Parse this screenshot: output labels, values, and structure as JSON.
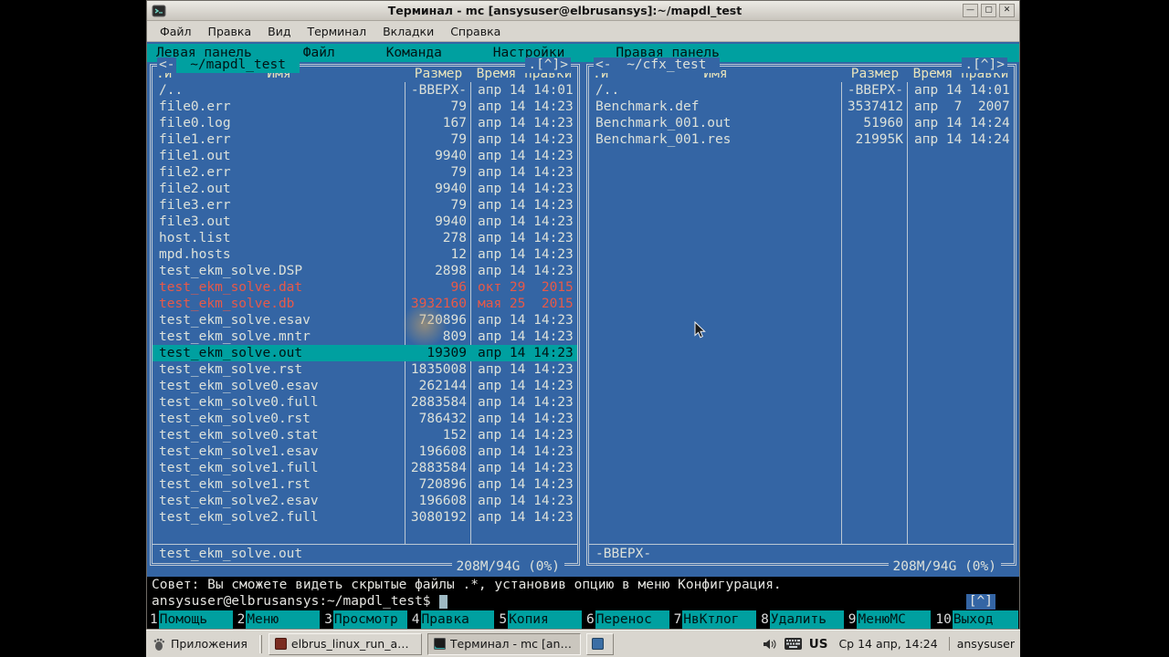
{
  "colors": {
    "terminal_blue": "#3465a4",
    "accent_cyan": "#00a0a0",
    "stale_red": "#e85948",
    "selected_bg": "#00a0a0",
    "taskbar_gray": "#d9d6cf"
  },
  "window": {
    "title": "Терминал - mc [ansysuser@elbrusansys]:~/mapdl_test",
    "controls": {
      "minimize": "—",
      "maximize": "▢",
      "close": "✕"
    },
    "menu": [
      "Файл",
      "Правка",
      "Вид",
      "Терминал",
      "Вкладки",
      "Справка"
    ]
  },
  "mc": {
    "menubar": [
      "Левая панель",
      "Файл",
      "Команда",
      "Настройки",
      "Правая панель"
    ],
    "panels": [
      {
        "side": "left",
        "active": true,
        "scroll_prefix": "<-",
        "path": " ~/mapdl_test ",
        "corner": ".[^]>",
        "sort_indicator": ".и",
        "columns": {
          "name": "Имя",
          "size": "Размер",
          "time": "Время правки"
        },
        "rows": [
          {
            "n": "/..",
            "s": "-ВВЕРХ-",
            "t": "апр 14 14:01"
          },
          {
            "n": "file0.err",
            "s": "79",
            "t": "апр 14 14:23"
          },
          {
            "n": "file0.log",
            "s": "167",
            "t": "апр 14 14:23"
          },
          {
            "n": "file1.err",
            "s": "79",
            "t": "апр 14 14:23"
          },
          {
            "n": "file1.out",
            "s": "9940",
            "t": "апр 14 14:23"
          },
          {
            "n": "file2.err",
            "s": "79",
            "t": "апр 14 14:23"
          },
          {
            "n": "file2.out",
            "s": "9940",
            "t": "апр 14 14:23"
          },
          {
            "n": "file3.err",
            "s": "79",
            "t": "апр 14 14:23"
          },
          {
            "n": "file3.out",
            "s": "9940",
            "t": "апр 14 14:23"
          },
          {
            "n": "host.list",
            "s": "278",
            "t": "апр 14 14:23"
          },
          {
            "n": "mpd.hosts",
            "s": "12",
            "t": "апр 14 14:23"
          },
          {
            "n": "test_ekm_solve.DSP",
            "s": "2898",
            "t": "апр 14 14:23"
          },
          {
            "n": "test_ekm_solve.dat",
            "s": "96",
            "t": "окт 29  2015",
            "st": "stale"
          },
          {
            "n": "test_ekm_solve.db",
            "s": "3932160",
            "t": "мая 25  2015",
            "st": "stale"
          },
          {
            "n": "test_ekm_solve.esav",
            "s": "720896",
            "t": "апр 14 14:23"
          },
          {
            "n": "test_ekm_solve.mntr",
            "s": "809",
            "t": "апр 14 14:23"
          },
          {
            "n": "test_ekm_solve.out",
            "s": "19309",
            "t": "апр 14 14:23",
            "st": "selected"
          },
          {
            "n": "test_ekm_solve.rst",
            "s": "1835008",
            "t": "апр 14 14:23"
          },
          {
            "n": "test_ekm_solve0.esav",
            "s": "262144",
            "t": "апр 14 14:23"
          },
          {
            "n": "test_ekm_solve0.full",
            "s": "2883584",
            "t": "апр 14 14:23"
          },
          {
            "n": "test_ekm_solve0.rst",
            "s": "786432",
            "t": "апр 14 14:23"
          },
          {
            "n": "test_ekm_solve0.stat",
            "s": "152",
            "t": "апр 14 14:23"
          },
          {
            "n": "test_ekm_solve1.esav",
            "s": "196608",
            "t": "апр 14 14:23"
          },
          {
            "n": "test_ekm_solve1.full",
            "s": "2883584",
            "t": "апр 14 14:23"
          },
          {
            "n": "test_ekm_solve1.rst",
            "s": "720896",
            "t": "апр 14 14:23"
          },
          {
            "n": "test_ekm_solve2.esav",
            "s": "196608",
            "t": "апр 14 14:23"
          },
          {
            "n": "test_ekm_solve2.full",
            "s": "3080192",
            "t": "апр 14 14:23"
          }
        ],
        "status_file": "test_ekm_solve.out",
        "usage": "208M/94G (0%)"
      },
      {
        "side": "right",
        "active": false,
        "scroll_prefix": "<-",
        "path": " ~/cfx_test ",
        "corner": ".[^]>",
        "sort_indicator": ".и",
        "columns": {
          "name": "Имя",
          "size": "Размер",
          "time": "Время правки"
        },
        "rows": [
          {
            "n": "/..",
            "s": "-ВВЕРХ-",
            "t": "апр 14 14:01"
          },
          {
            "n": "Benchmark.def",
            "s": "3537412",
            "t": "апр  7  2007"
          },
          {
            "n": "Benchmark_001.out",
            "s": "51960",
            "t": "апр 14 14:24"
          },
          {
            "n": "Benchmark_001.res",
            "s": "21995K",
            "t": "апр 14 14:24"
          }
        ],
        "status_file": "-ВВЕРХ-",
        "usage": "208M/94G (0%)"
      }
    ],
    "hint": "Совет: Вы сможете видеть скрытые файлы .*, установив опцию в меню Конфигурация.",
    "prompt": "ansysuser@elbrusansys:~/mapdl_test$",
    "scroll_corner": "[^]",
    "fkeys": [
      {
        "num": "1",
        "label": "Помощь"
      },
      {
        "num": "2",
        "label": "Меню"
      },
      {
        "num": "3",
        "label": "Просмотр"
      },
      {
        "num": "4",
        "label": "Правка"
      },
      {
        "num": "5",
        "label": "Копия"
      },
      {
        "num": "6",
        "label": "Перенос"
      },
      {
        "num": "7",
        "label": "НвКтлог"
      },
      {
        "num": "8",
        "label": "Удалить"
      },
      {
        "num": "9",
        "label": "МенюМС"
      },
      {
        "num": "10",
        "label": "Выход"
      }
    ]
  },
  "taskbar": {
    "applications": "Приложения",
    "tasks": [
      {
        "label": "elbrus_linux_run_ansys...",
        "icon": "document",
        "active": false,
        "narrow": false
      },
      {
        "label": "Терминал - mc [ansysu...",
        "icon": "terminal",
        "active": true,
        "narrow": false
      },
      {
        "label": "",
        "icon": "files",
        "active": false,
        "narrow": true
      }
    ],
    "keyboard_layout": "US",
    "clock": "Ср 14 апр, 14:24",
    "user": "ansysuser"
  }
}
